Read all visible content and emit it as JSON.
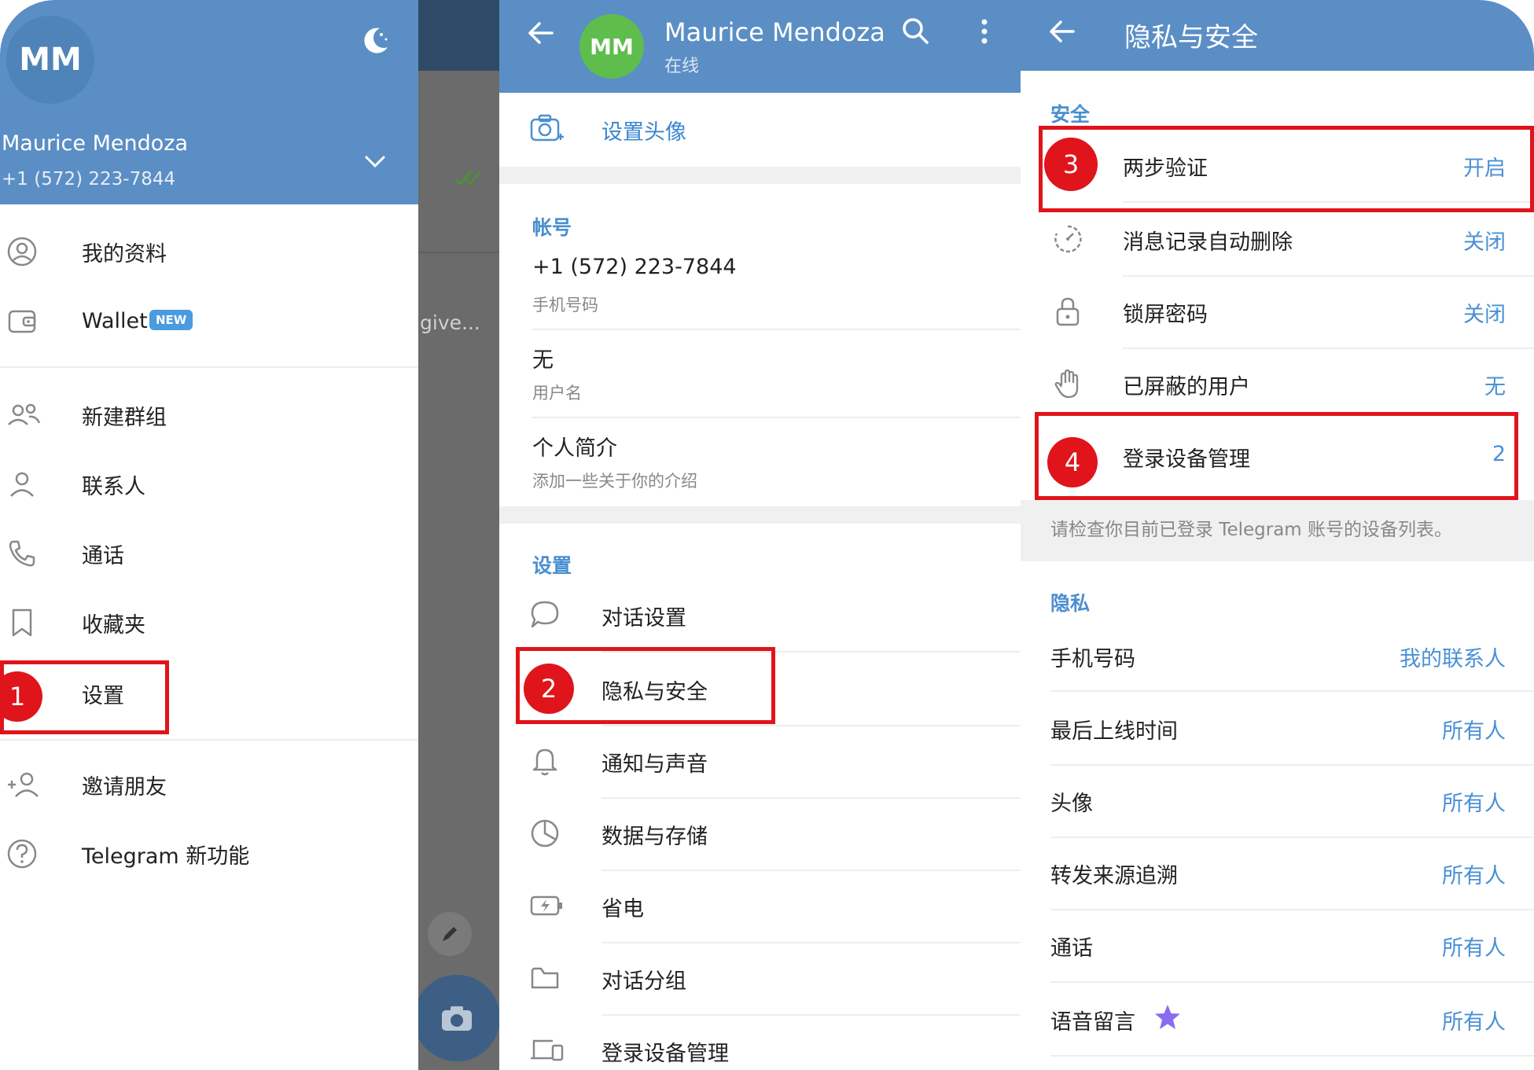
{
  "drawer": {
    "avatar_initials": "MM",
    "name": "Maurice Mendoza",
    "phone": "+1 (572) 223-7844",
    "items": [
      {
        "label": "我的资料",
        "icon": "profile-icon"
      },
      {
        "label": "Wallet",
        "icon": "wallet-icon",
        "badge": "NEW"
      },
      {
        "label": "新建群组",
        "icon": "group-icon"
      },
      {
        "label": "联系人",
        "icon": "contact-icon"
      },
      {
        "label": "通话",
        "icon": "phone-icon"
      },
      {
        "label": "收藏夹",
        "icon": "bookmark-icon"
      },
      {
        "label": "设置",
        "icon": "settings-icon"
      },
      {
        "label": "邀请朋友",
        "icon": "add-person-icon"
      },
      {
        "label": "Telegram 新功能",
        "icon": "help-icon"
      }
    ]
  },
  "chat_behind": {
    "preview_text": "give..."
  },
  "settings": {
    "avatar_initials": "MM",
    "name": "Maurice Mendoza",
    "status": "在线",
    "set_photo": "设置头像",
    "account_section": "帐号",
    "phone_value": "+1 (572) 223-7844",
    "phone_caption": "手机号码",
    "username_value": "无",
    "username_caption": "用户名",
    "bio_value": "个人简介",
    "bio_caption": "添加一些关于你的介绍",
    "settings_section": "设置",
    "items": [
      {
        "label": "对话设置",
        "icon": "chat-bubble-icon"
      },
      {
        "label": "隐私与安全",
        "icon": "lock-icon"
      },
      {
        "label": "通知与声音",
        "icon": "bell-icon"
      },
      {
        "label": "数据与存储",
        "icon": "pie-chart-icon"
      },
      {
        "label": "省电",
        "icon": "battery-icon"
      },
      {
        "label": "对话分组",
        "icon": "folder-icon"
      },
      {
        "label": "登录设备管理",
        "icon": "devices-icon"
      }
    ]
  },
  "privacy": {
    "title": "隐私与安全",
    "security_section": "安全",
    "security_items": [
      {
        "label": "两步验证",
        "value": "开启",
        "icon": "key-icon"
      },
      {
        "label": "消息记录自动删除",
        "value": "关闭",
        "icon": "timer-icon"
      },
      {
        "label": "锁屏密码",
        "value": "关闭",
        "icon": "lock-icon"
      },
      {
        "label": "已屏蔽的用户",
        "value": "无",
        "icon": "hand-icon"
      },
      {
        "label": "登录设备管理",
        "value": "2",
        "icon": "devices-icon"
      }
    ],
    "devices_hint": "请检查你目前已登录 Telegram 账号的设备列表。",
    "privacy_section": "隐私",
    "privacy_items": [
      {
        "label": "手机号码",
        "value": "我的联系人"
      },
      {
        "label": "最后上线时间",
        "value": "所有人"
      },
      {
        "label": "头像",
        "value": "所有人"
      },
      {
        "label": "转发来源追溯",
        "value": "所有人"
      },
      {
        "label": "通话",
        "value": "所有人"
      },
      {
        "label": "语音留言",
        "value": "所有人"
      }
    ]
  },
  "annotations": {
    "steps": [
      "1",
      "2",
      "3",
      "4"
    ],
    "highlight_color": "#e0141b"
  },
  "colors": {
    "header_blue": "#5b8ec4",
    "accent_blue": "#4a90d6",
    "premium_star": "#8a6cf0"
  }
}
